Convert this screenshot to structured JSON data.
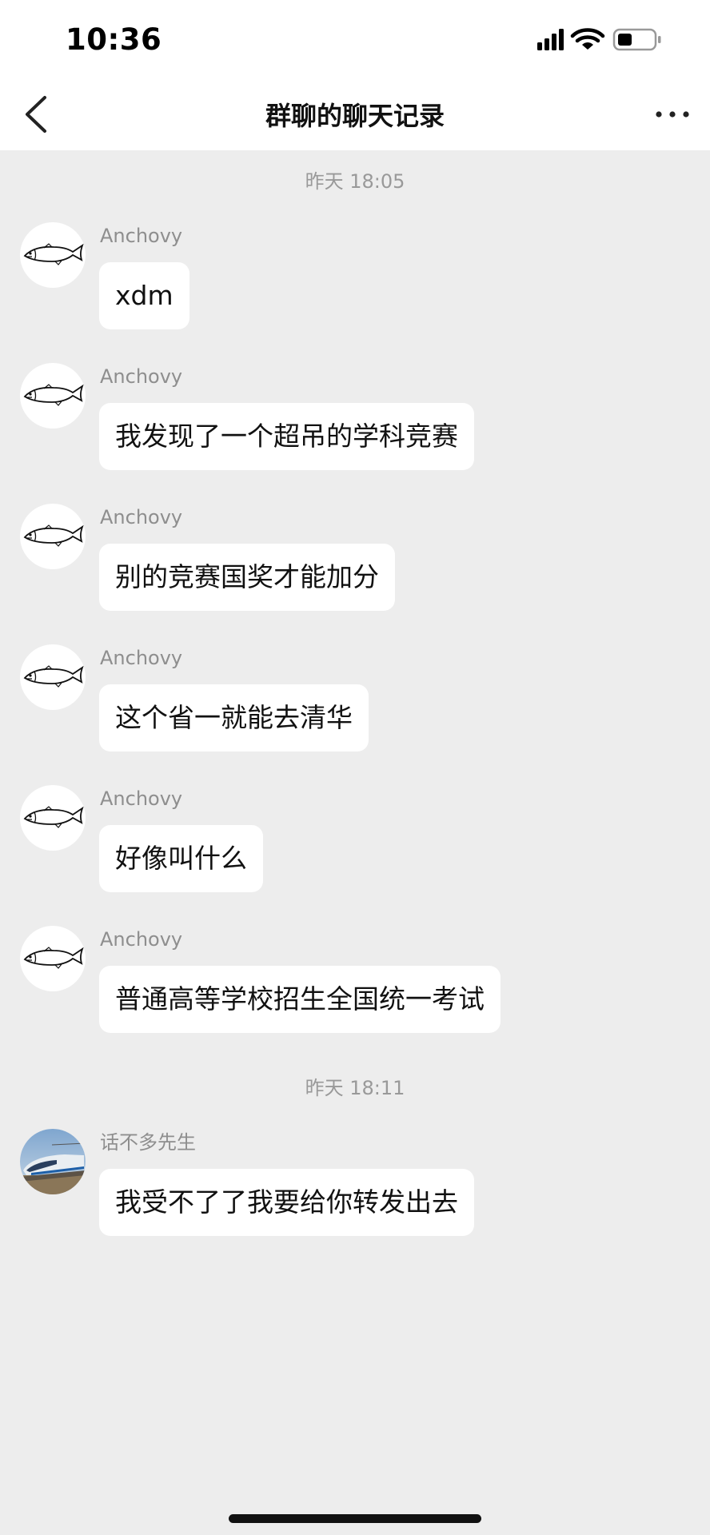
{
  "status_bar": {
    "time": "10:36",
    "icons": [
      "signal-icon",
      "wifi-icon",
      "battery-icon"
    ]
  },
  "nav": {
    "title": "群聊的聊天记录",
    "back_icon": "chevron-left-icon",
    "more_icon": "more-dots-icon"
  },
  "conversation": {
    "timestamps": [
      "昨天 18:05",
      "昨天 18:11"
    ],
    "messages": [
      {
        "sender": "Anchovy",
        "text": "xdm",
        "avatar": "fish-icon"
      },
      {
        "sender": "Anchovy",
        "text": "我发现了一个超吊的学科竞赛",
        "avatar": "fish-icon"
      },
      {
        "sender": "Anchovy",
        "text": "别的竞赛国奖才能加分",
        "avatar": "fish-icon"
      },
      {
        "sender": "Anchovy",
        "text": "这个省一就能去清华",
        "avatar": "fish-icon"
      },
      {
        "sender": "Anchovy",
        "text": "好像叫什么",
        "avatar": "fish-icon"
      },
      {
        "sender": "Anchovy",
        "text": "普通高等学校招生全国统一考试",
        "avatar": "fish-icon"
      },
      {
        "sender": "话不多先生",
        "text": "我受不了了我要给你转发出去",
        "avatar": "train-photo"
      }
    ]
  },
  "colors": {
    "background": "#ededed",
    "bubble": "#ffffff",
    "header": "#ffffff",
    "secondary_text": "#999999"
  }
}
